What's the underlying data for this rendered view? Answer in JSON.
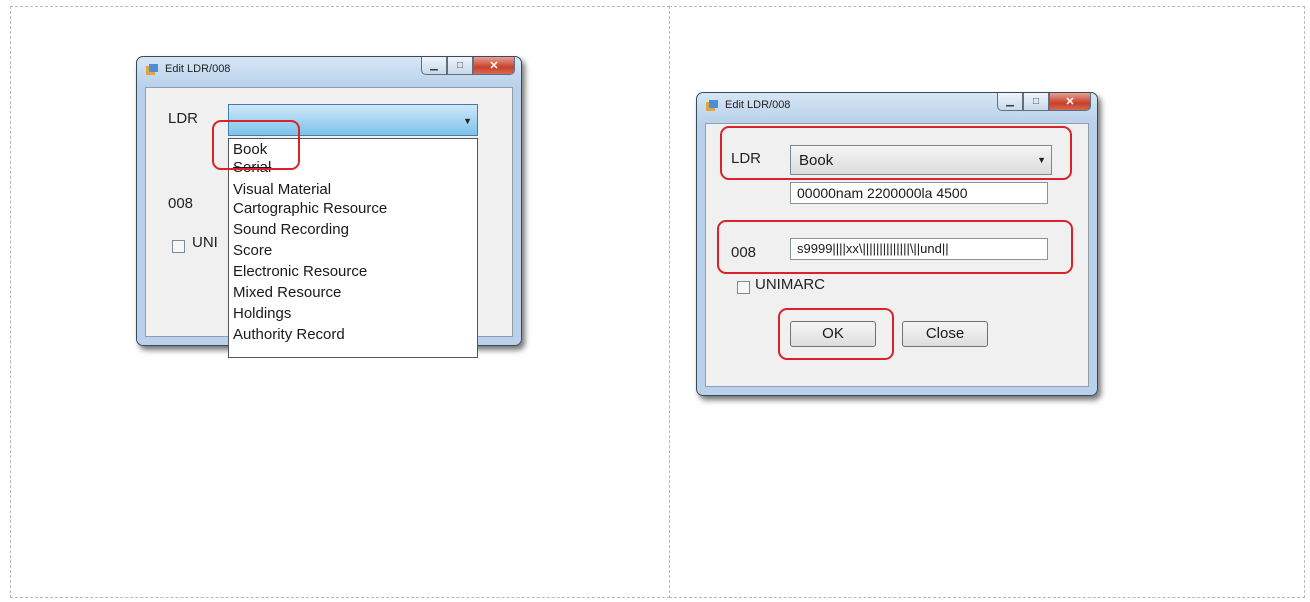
{
  "window_title": "Edit LDR/008",
  "left_dialog": {
    "ldr_label": "LDR",
    "ldr_value": "",
    "label_008": "008",
    "unimarc_label": "UNI",
    "dropdown_options": [
      "Book",
      "Serial",
      "Visual Material",
      "Cartographic Resource",
      "Sound Recording",
      "Score",
      "Electronic Resource",
      "Mixed Resource",
      "Holdings",
      "Authority Record"
    ]
  },
  "right_dialog": {
    "ldr_label": "LDR",
    "ldr_value": "Book",
    "ldr_text": "00000nam  2200000la 4500",
    "label_008": "008",
    "field_008": "s9999||||xx\\||||||||||||||\\||und||",
    "unimarc_label": "UNIMARC",
    "ok_label": "OK",
    "close_label": "Close"
  },
  "icons": {
    "minimize": "minimize-icon",
    "maximize": "maximize-icon",
    "close": "close-icon",
    "app": "app-icon",
    "dropdown": "chevron-down-icon"
  },
  "colors": {
    "highlight_box": "#d8222c",
    "combo_focus": "#7cc3ec",
    "caption_close": "#c7402a"
  }
}
